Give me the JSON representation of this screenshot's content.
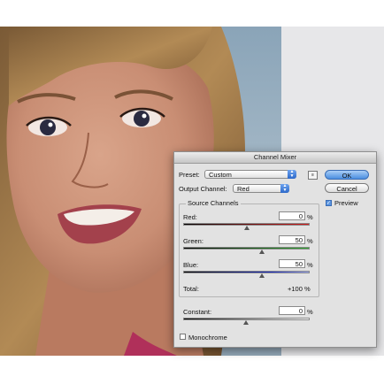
{
  "dialog": {
    "title": "Channel Mixer",
    "preset_label": "Preset:",
    "preset_value": "Custom",
    "output_label": "Output Channel:",
    "output_value": "Red",
    "ok_label": "OK",
    "cancel_label": "Cancel",
    "preview_label": "Preview",
    "preview_checked": true,
    "source_group_label": "Source Channels",
    "channels": [
      {
        "label": "Red:",
        "value": "0",
        "level": 0
      },
      {
        "label": "Green:",
        "value": "50",
        "level": 50
      },
      {
        "label": "Blue:",
        "value": "50",
        "level": 50
      }
    ],
    "percent_sign": "%",
    "total_label": "Total:",
    "total_value": "+100 %",
    "constant_label": "Constant:",
    "constant_value": "0",
    "monochrome_label": "Monochrome",
    "monochrome_checked": false
  },
  "colors": {
    "ok_accent": "#4b8ee0",
    "red_slider": "#d21c1c",
    "green_slider": "#2fa830",
    "blue_slider": "#1b2cc6"
  }
}
